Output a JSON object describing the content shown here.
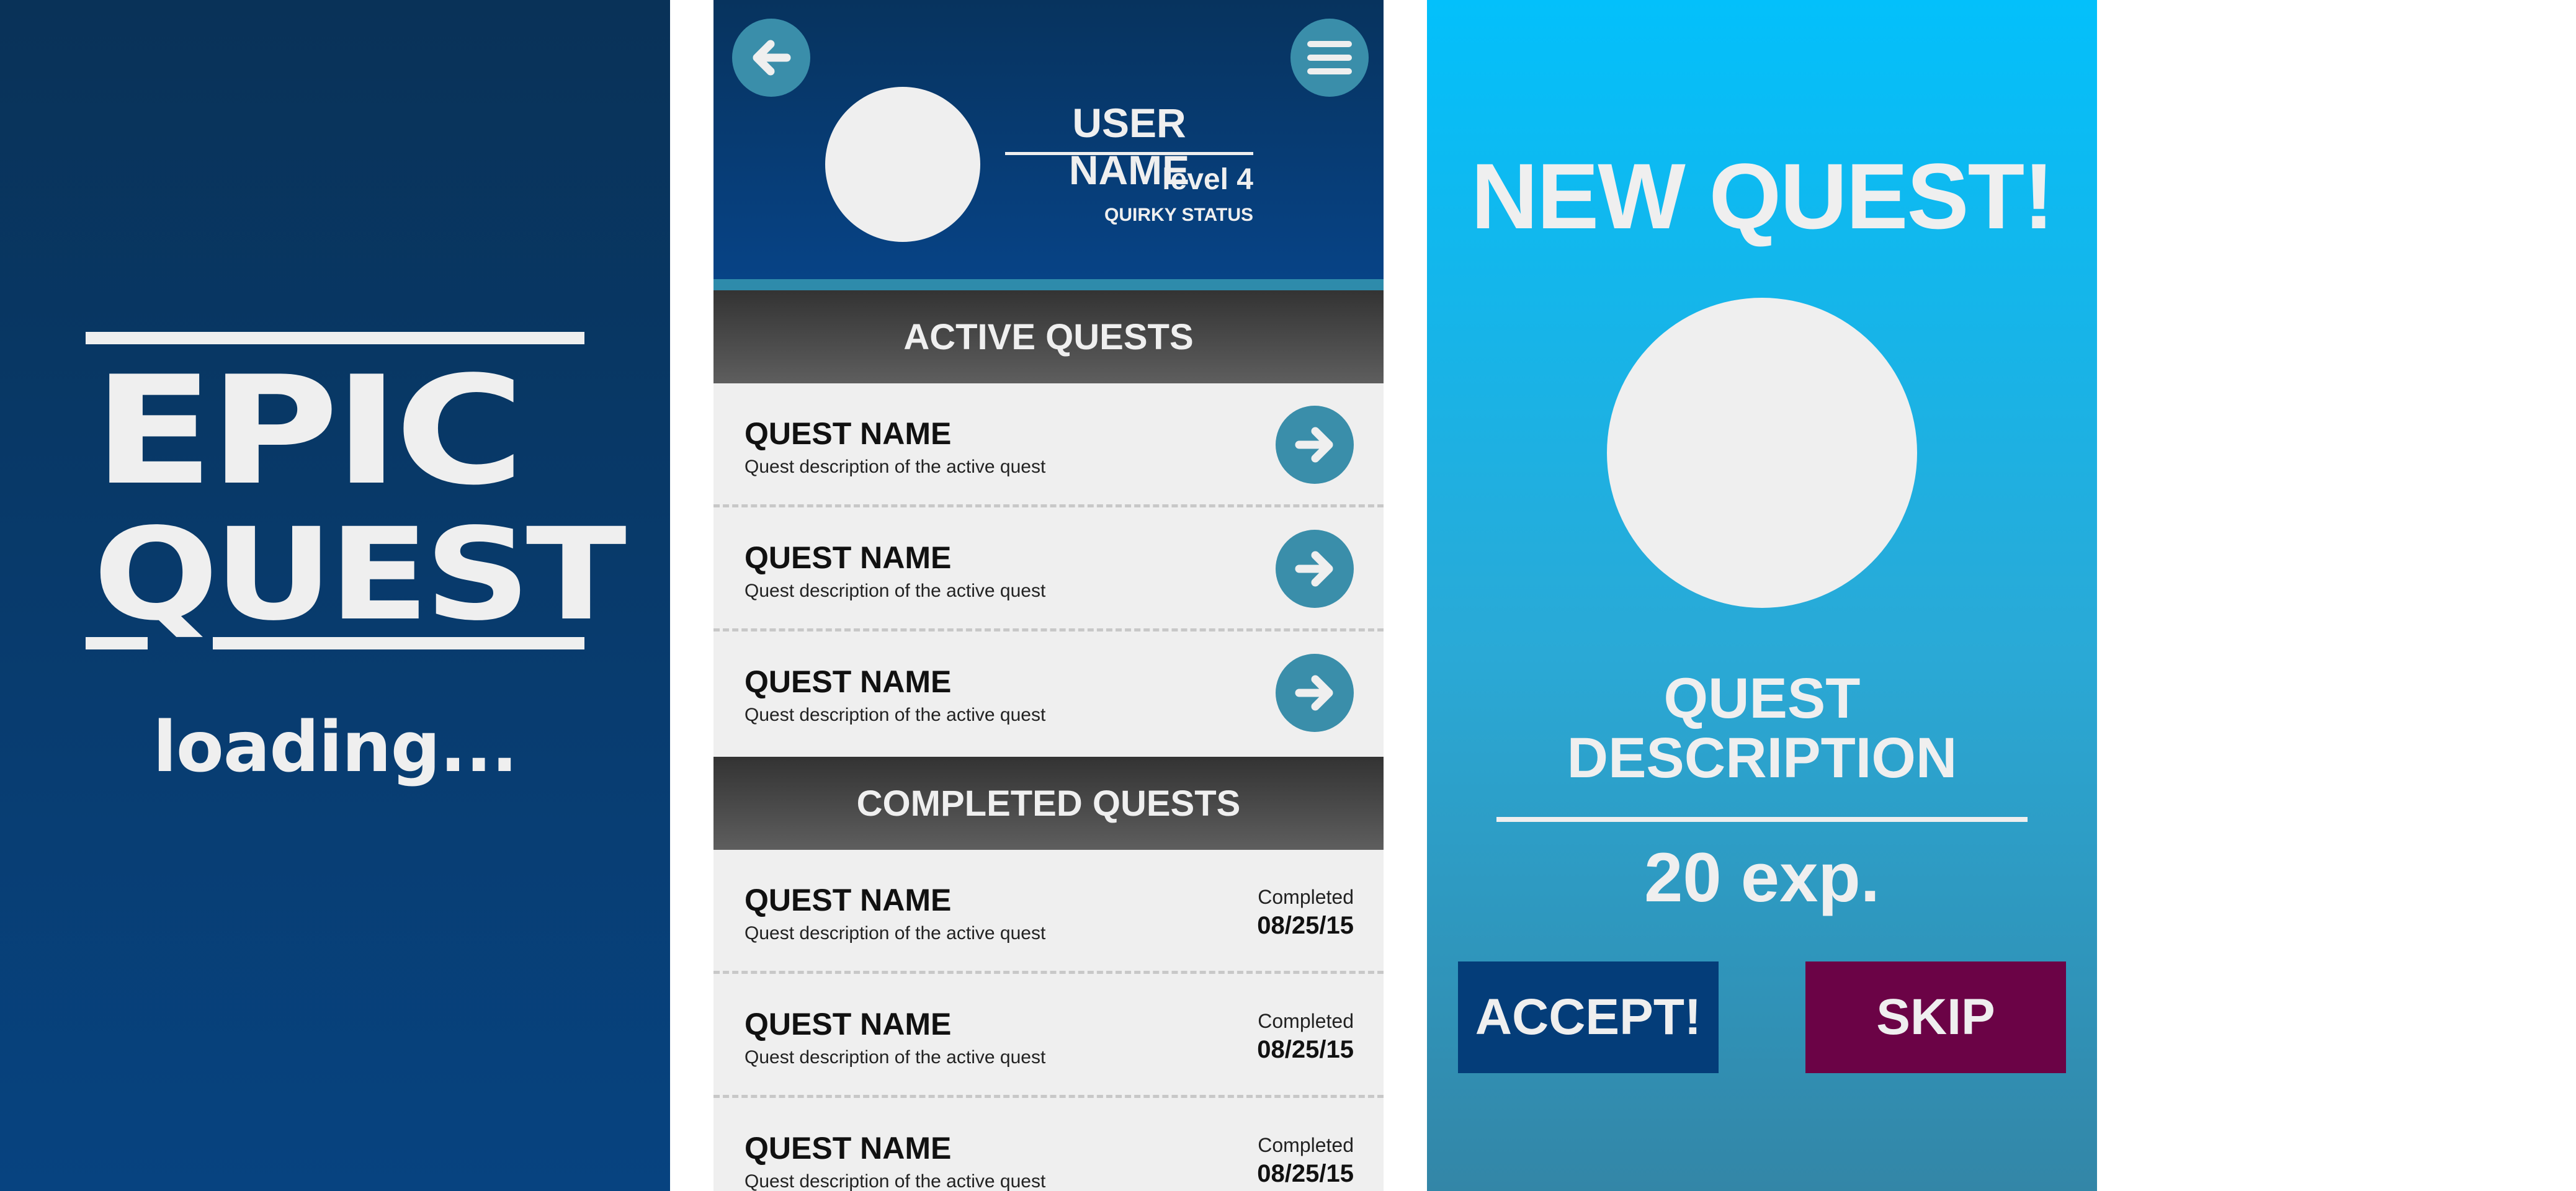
{
  "loading_screen": {
    "logo_line1": "EPIC",
    "logo_line2": "QUEST",
    "loading_text": "loading..."
  },
  "profile": {
    "back_icon": "arrow-left-icon",
    "menu_icon": "hamburger-menu-icon",
    "user_name": "USER NAME",
    "level": "level 4",
    "status": "QUIRKY STATUS"
  },
  "active_section": {
    "title": "ACTIVE QUESTS",
    "items": [
      {
        "name": "QUEST NAME",
        "description": "Quest description of the active quest"
      },
      {
        "name": "QUEST NAME",
        "description": "Quest description of the active quest"
      },
      {
        "name": "QUEST NAME",
        "description": "Quest description of the active quest"
      }
    ]
  },
  "completed_section": {
    "title": "COMPLETED QUESTS",
    "items": [
      {
        "name": "QUEST NAME",
        "description": "Quest description of the active quest",
        "status": "Completed",
        "date": "08/25/15"
      },
      {
        "name": "QUEST NAME",
        "description": "Quest description of the active quest",
        "status": "Completed",
        "date": "08/25/15"
      },
      {
        "name": "QUEST NAME",
        "description": "Quest description of the active quest",
        "status": "Completed",
        "date": "08/25/15"
      }
    ]
  },
  "new_quest_screen": {
    "title": "NEW QUEST!",
    "description_line1": "QUEST",
    "description_line2": "DESCRIPTION",
    "exp": "20 exp.",
    "accept_label": "ACCEPT!",
    "skip_label": "SKIP"
  },
  "colors": {
    "loading_bg": "#074380",
    "header_bg": "#07335e",
    "accent_teal": "#3a8eaa",
    "new_quest_bg": "#03c0fb",
    "accept_btn": "#043d79",
    "skip_btn": "#6b0346",
    "text_light": "#efefef"
  }
}
